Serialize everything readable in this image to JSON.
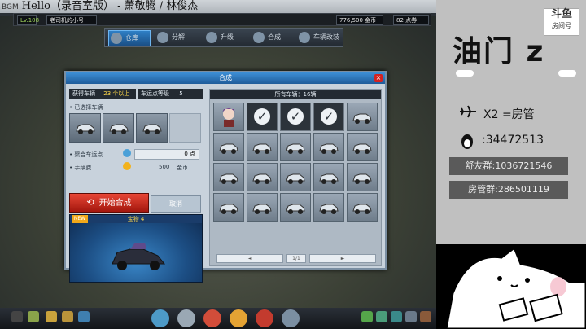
{
  "bgm": {
    "tag": "BGM",
    "text": "Hello（录音室版） - 萧敬腾 / 林俊杰"
  },
  "topbar": {
    "level": "Lv.108",
    "name": "老司机的小号",
    "coins": "776,500 金币",
    "points": "82 点券"
  },
  "nav": {
    "tabs": [
      {
        "label": "仓库"
      },
      {
        "label": "分解"
      },
      {
        "label": "升级"
      },
      {
        "label": "合成"
      },
      {
        "label": "车辆改装"
      }
    ]
  },
  "modal": {
    "title": "合成",
    "close": "×",
    "left": {
      "header_label": "获得车辆",
      "header_value": "23 个以上",
      "header_right_label": "车运点等级",
      "header_right_value": "5",
      "selected_label": "• 已选择车辆",
      "points_label": "• 聚合车运点",
      "points_value": "0 点",
      "fee_label": "• 手续费",
      "fee_value": "500",
      "fee_unit": "金币",
      "start_button": "开始合成",
      "cancel_button": "取消",
      "preview_title": "宝物 4",
      "new_badge": "NEW"
    },
    "right": {
      "header": "所有车辆：16辆",
      "page": "1/1"
    }
  },
  "overlay": {
    "title": "油门 z",
    "douyu": "斗鱼",
    "douyu_sub": "房间号",
    "plane_text": "X2 =房管",
    "qq_text": ":34472513",
    "fan_group": "舒友群:1036721546",
    "admin_group": "房管群:286501119"
  },
  "colors": {
    "accent_blue": "#2f7fc5",
    "start_red": "#d93425",
    "overlay_bg": "#c0c0c0"
  },
  "icons": {
    "check": "check-icon",
    "close": "close-icon",
    "car": "car-icon",
    "plane": "plane-icon",
    "qq": "qq-penguin-icon"
  }
}
